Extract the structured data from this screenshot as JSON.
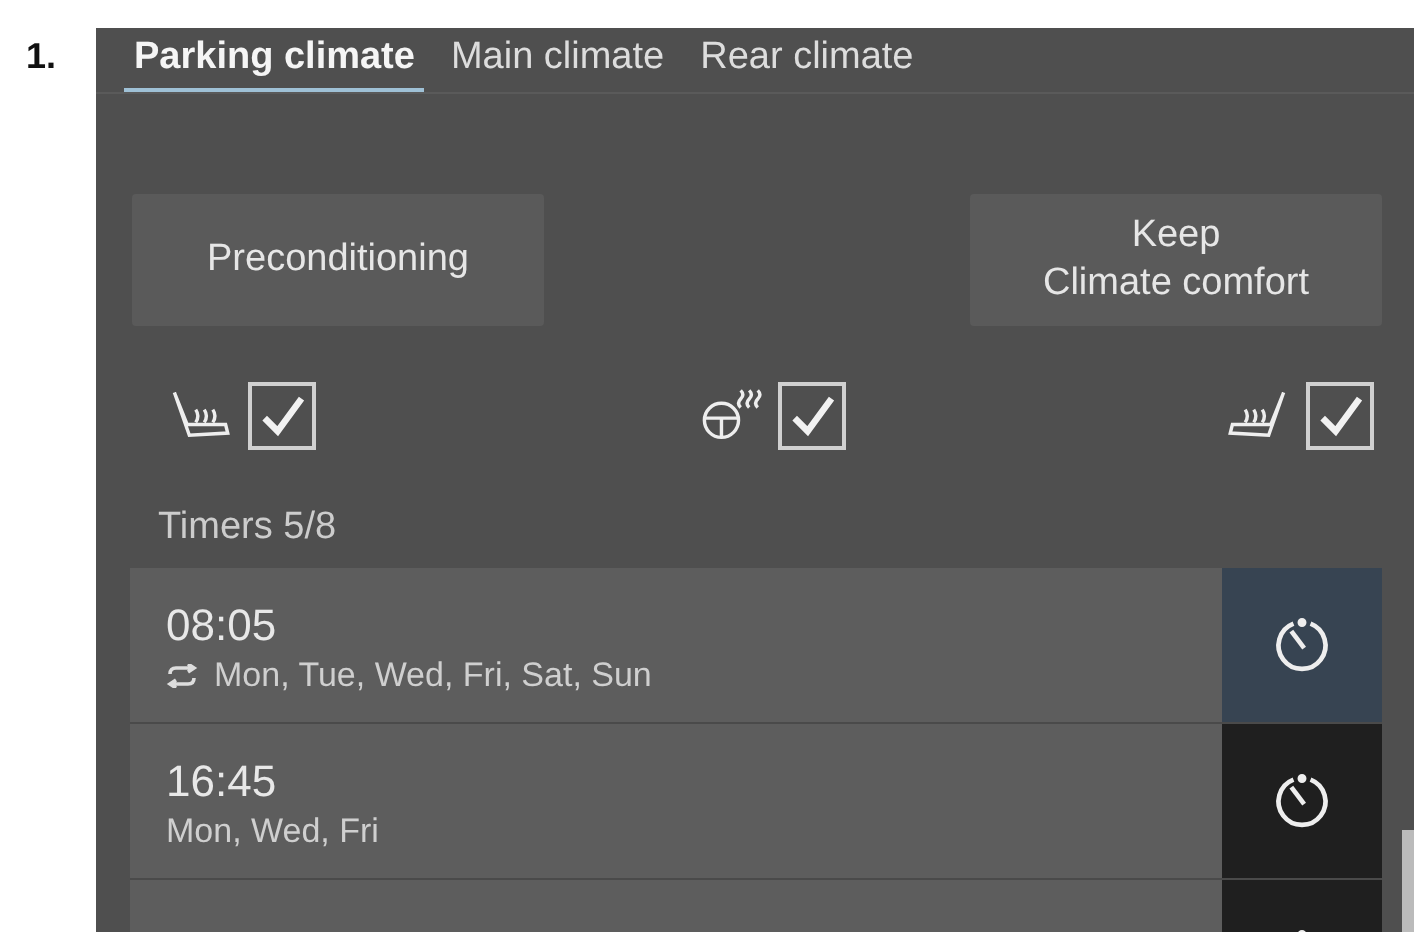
{
  "figure_label": "1.",
  "tabs": [
    {
      "label": "Parking climate",
      "selected": true
    },
    {
      "label": "Main climate",
      "selected": false
    },
    {
      "label": "Rear climate",
      "selected": false
    }
  ],
  "buttons": [
    "Preconditioning",
    "Keep\nClimate comfort"
  ],
  "options": [
    {
      "kind": "seat-left",
      "checked": true
    },
    {
      "kind": "steering-wheel",
      "checked": true
    },
    {
      "kind": "seat-right",
      "checked": true
    }
  ],
  "timers_label": "Timers 5/8",
  "timers": [
    {
      "time": "08:05",
      "days": "Mon, Tue, Wed, Fri, Sat, Sun",
      "repeat": true,
      "selected": true
    },
    {
      "time": "16:45",
      "days": "Mon, Wed, Fri",
      "repeat": false,
      "selected": false
    },
    {
      "selected": false
    }
  ]
}
